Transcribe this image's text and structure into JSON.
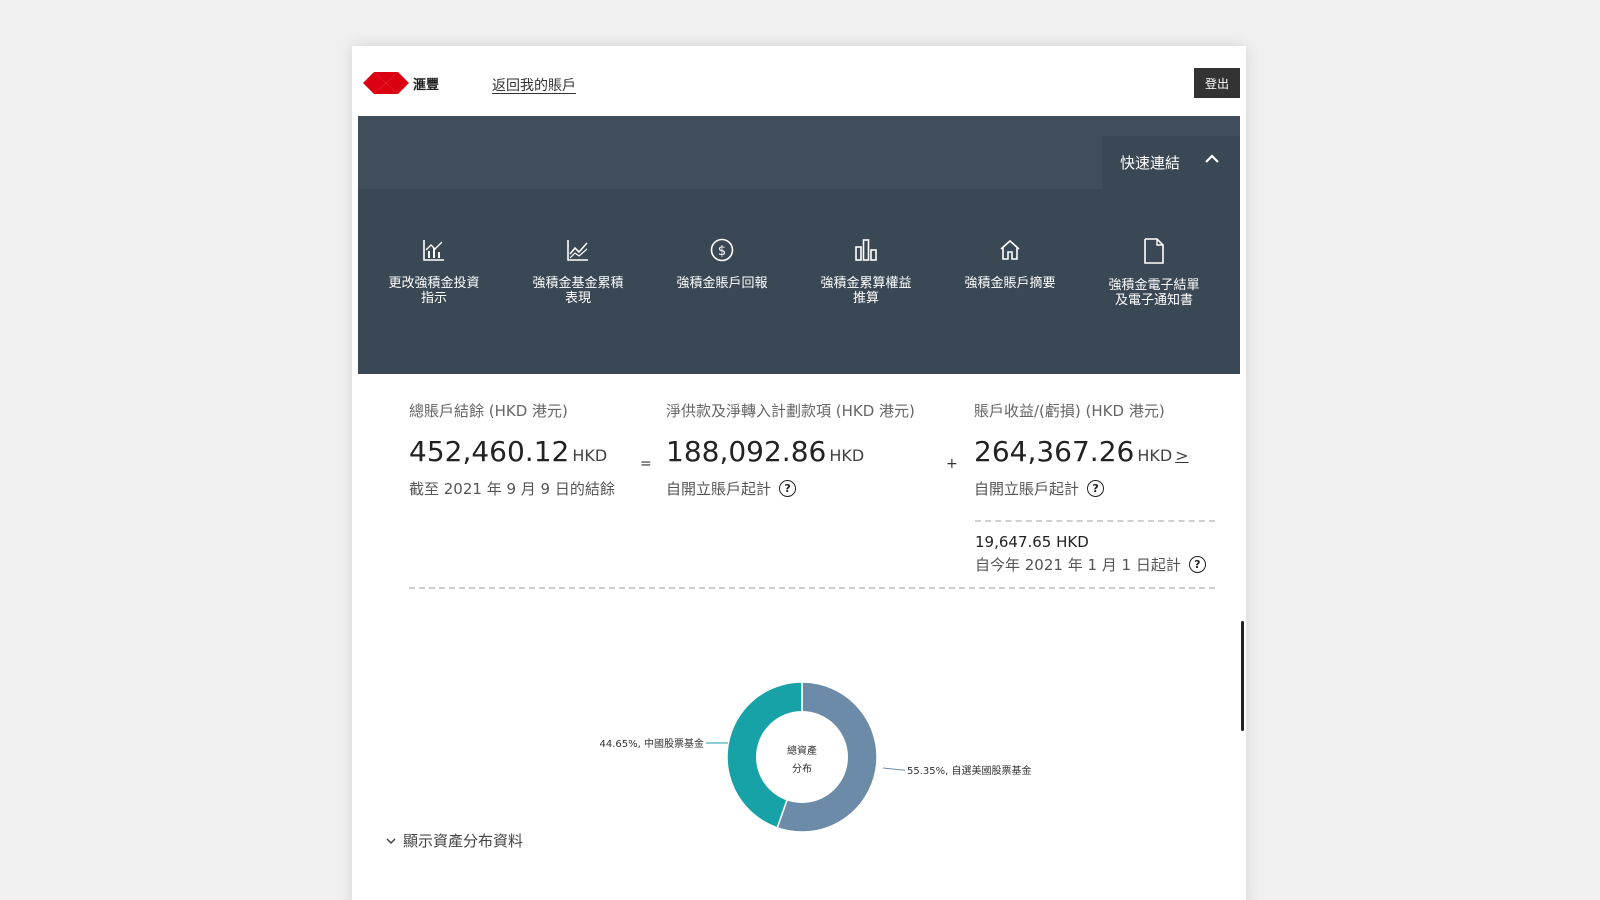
{
  "header": {
    "logo_text": "滙豐",
    "back_link": "返回我的賬戶",
    "logout": "登出"
  },
  "quick_links": {
    "toggle_label": "快速連結",
    "items": [
      {
        "icon": "chart-bars-icon",
        "label": "更改強積金投資\n指示"
      },
      {
        "icon": "line-chart-icon",
        "label": "強積金基金累積\n表現"
      },
      {
        "icon": "dollar-circle-icon",
        "label": "強積金賬戶回報"
      },
      {
        "icon": "bar-chart-icon",
        "label": "強積金累算權益\n推算"
      },
      {
        "icon": "home-icon",
        "label": "強積金賬戶摘要"
      },
      {
        "icon": "document-icon",
        "label": "強積金電子結單\n及電子通知書"
      }
    ]
  },
  "summary": {
    "balance": {
      "title": "總賬戶結餘 (HKD 港元)",
      "amount": "452,460.12",
      "currency": "HKD",
      "subtitle": "截至 2021 年 9 月 9 日的結餘"
    },
    "equals": "=",
    "contributions": {
      "title": "淨供款及淨轉入計劃款項 (HKD 港元)",
      "amount": "188,092.86",
      "currency": "HKD",
      "subtitle": "自開立賬戶起計"
    },
    "plus": "+",
    "gain": {
      "title": "賬戶收益/(虧損) (HKD 港元)",
      "amount": "264,367.26",
      "currency": "HKD",
      "arrow": ">",
      "subtitle": "自開立賬戶起計"
    },
    "ytd": {
      "amount": "19,647.65 HKD",
      "subtitle": "自今年 2021 年 1 月 1 日起計"
    },
    "help_symbol": "?"
  },
  "chart_data": {
    "type": "pie",
    "center_label_line1": "總資產",
    "center_label_line2": "分布",
    "slices": [
      {
        "label": "55.35%, 自選美國股票基金",
        "value": 55.35,
        "color": "#6b8ba8"
      },
      {
        "label": "44.65%, 中國股票基金",
        "value": 44.65,
        "color": "#17a2a8"
      }
    ]
  },
  "show_more": {
    "label": "顯示資產分布資料"
  },
  "colors": {
    "panel": "#394854",
    "logo_red": "#db0011"
  }
}
